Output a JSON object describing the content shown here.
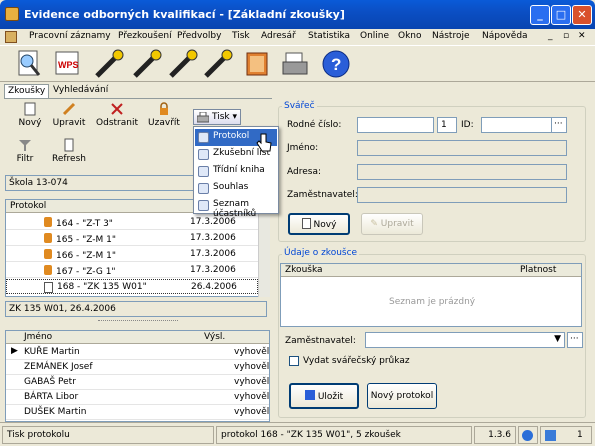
{
  "window": {
    "title": "Evidence odborných kvalifikací - [Základní zkoušky]"
  },
  "menu": [
    "Pracovní záznamy",
    "Přezkoušení",
    "Předvolby",
    "Tisk",
    "Adresář",
    "Statistika",
    "Online",
    "Okno",
    "Nástroje",
    "Nápověda"
  ],
  "toolbar": {
    "wps_label": "WPS",
    "help": "?"
  },
  "tabs": {
    "zkousky": "Zkoušky",
    "vyhledavani": "Vyhledávání"
  },
  "actions": {
    "novy": "Nový",
    "upravit": "Upravit",
    "odstranit": "Odstranit",
    "uzavrit": "Uzavřít",
    "tisk": "Tisk",
    "filtr": "Filtr",
    "refresh": "Refresh"
  },
  "dropdown": [
    "Protokol",
    "Zkušební list",
    "Třídní kniha",
    "Souhlas",
    "Seznam účastníků"
  ],
  "school": "Škola 13-074",
  "protocols": {
    "header": "Protokol",
    "rows": [
      {
        "name": "164 - \"Z-T 3\"",
        "date": "17.3.2006"
      },
      {
        "name": "165 - \"Z-M 1\"",
        "date": "17.3.2006"
      },
      {
        "name": "166 - \"Z-M 1\"",
        "date": "17.3.2006"
      },
      {
        "name": "167 - \"Z-G 1\"",
        "date": "17.3.2006"
      },
      {
        "name": "168 - \"ZK 135 W01\"",
        "date": "26.4.2006"
      }
    ]
  },
  "selected_exam": "ZK 135 W01, 26.4.2006",
  "participants": {
    "col_name": "Jméno",
    "col_result": "Výsl.",
    "rows": [
      {
        "name": "KUŘE Martin",
        "result": "vyhověl"
      },
      {
        "name": "ZEMÁNEK Josef",
        "result": "vyhověl"
      },
      {
        "name": "GABAŠ Petr",
        "result": "vyhověl"
      },
      {
        "name": "BÁRTA Libor",
        "result": "vyhověl"
      },
      {
        "name": "DUŠEK Martin",
        "result": "vyhověl"
      }
    ]
  },
  "welder": {
    "group": "Svářeč",
    "rodne_label": "Rodné číslo:",
    "num_value": "1",
    "id_label": "ID:",
    "jmeno_label": "Jméno:",
    "adresa_label": "Adresa:",
    "zam_label": "Zaměstnavatel:",
    "novy": "Nový",
    "upravit": "Upravit"
  },
  "exam": {
    "group": "Údaje o zkoušce",
    "col1": "Zkouška",
    "col2": "Platnost",
    "empty": "Seznam je prázdný",
    "zam_label": "Zaměstnavatel:",
    "checkbox": "Vydat svářečský průkaz",
    "ulozit": "Uložit",
    "novy_protokol": "Nový protokol"
  },
  "status": {
    "left": "Tisk protokolu",
    "mid": "protokol 168 - \"ZK 135 W01\", 5 zkoušek",
    "version": "1.3.6",
    "count": "1"
  }
}
